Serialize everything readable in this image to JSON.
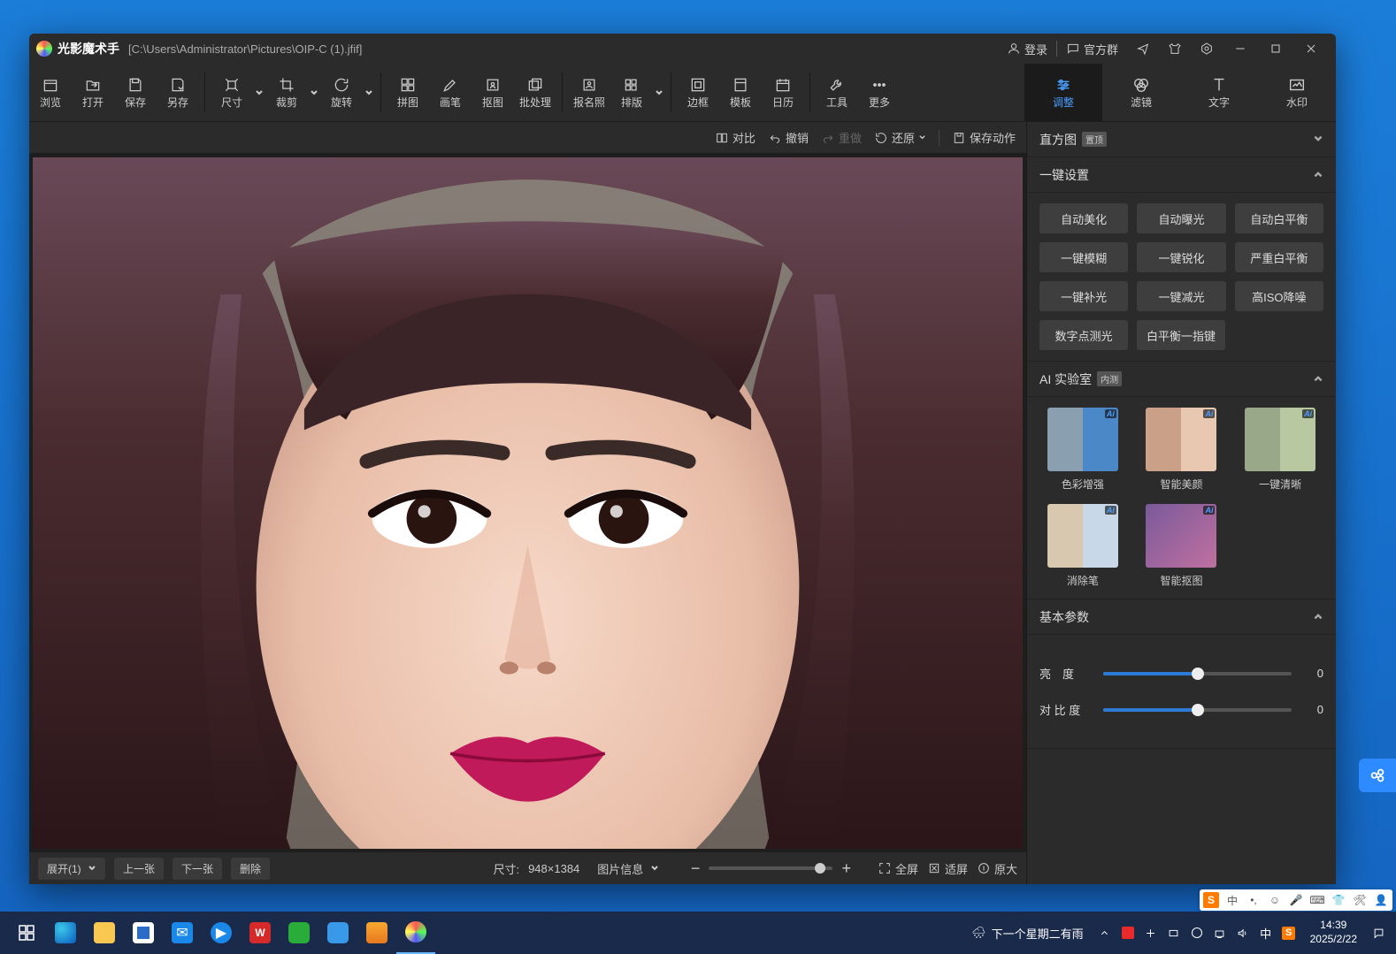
{
  "title": {
    "app": "光影魔术手",
    "path": "[C:\\Users\\Administrator\\Pictures\\OIP-C (1).jfif]"
  },
  "titlebar": {
    "login": "登录",
    "group": "官方群"
  },
  "toolbar": {
    "browse": "浏览",
    "open": "打开",
    "save": "保存",
    "saveas": "另存",
    "size": "尺寸",
    "crop": "裁剪",
    "rotate": "旋转",
    "puzzle": "拼图",
    "brush": "画笔",
    "cutout": "抠图",
    "batch": "批处理",
    "idphoto": "报名照",
    "layout": "排版",
    "border": "边框",
    "template": "模板",
    "calendar": "日历",
    "tools": "工具",
    "more": "更多"
  },
  "righttools": {
    "adjust": "调整",
    "filter": "滤镜",
    "text": "文字",
    "watermark": "水印"
  },
  "subbar": {
    "compare": "对比",
    "undo": "撤销",
    "redo": "重做",
    "restore": "还原",
    "saveaction": "保存动作"
  },
  "panels": {
    "histogram": {
      "title": "直方图",
      "badge": "置顶"
    },
    "oneclick": {
      "title": "一键设置",
      "btns": [
        "自动美化",
        "自动曝光",
        "自动白平衡",
        "一键模糊",
        "一键锐化",
        "严重白平衡",
        "一键补光",
        "一键减光",
        "高ISO降噪"
      ],
      "btns2": [
        "数字点测光",
        "白平衡一指键"
      ]
    },
    "ailab": {
      "title": "AI 实验室",
      "badge": "内测",
      "items": [
        "色彩增强",
        "智能美颜",
        "一键清晰",
        "消除笔",
        "智能抠图"
      ]
    },
    "basic": {
      "title": "基本参数",
      "brightness_lbl": "亮　度",
      "brightness_val": "0",
      "contrast_lbl": "对 比 度",
      "contrast_val": "0"
    }
  },
  "bottombar": {
    "expand": "展开(1)",
    "prev": "上一张",
    "next": "下一张",
    "delete": "删除",
    "size_lbl": "尺寸:",
    "size_val": "948×1384",
    "info": "图片信息",
    "full": "全屏",
    "fit": "适屏",
    "orig": "原大"
  },
  "taskbar": {
    "weather": "下一个星期二有雨",
    "time": "14:39",
    "date": "2025/2/22",
    "cn": "中"
  }
}
